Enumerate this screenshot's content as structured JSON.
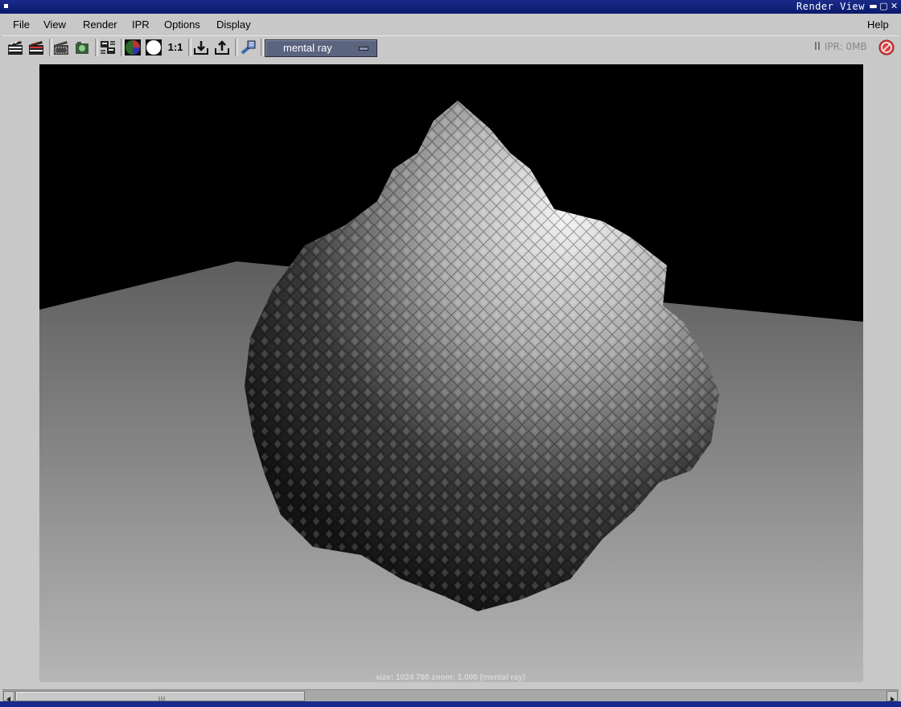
{
  "window": {
    "title": "Render View"
  },
  "menubar": {
    "items": [
      "File",
      "View",
      "Render",
      "IPR",
      "Options",
      "Display"
    ],
    "help": "Help"
  },
  "toolbar": {
    "buttons": [
      "render-icon",
      "redo-render-icon",
      "render-region-icon",
      "snapshot-icon",
      "render-settings-icon",
      "color-channels-icon",
      "alpha-channel-icon",
      "real-size-icon",
      "keep-image-icon",
      "remove-image-icon",
      "ipr-tuning-icon"
    ],
    "real_size_label": "1:1",
    "renderer": "mental ray",
    "ipr_status": "IPR: 0MB"
  },
  "viewport": {
    "status": "size: 1024  768 zoom: 1.000  (mental ray)"
  },
  "colors": {
    "titlebar": "#1a2a8a",
    "renderer_bg": "#5b647e",
    "chrome": "#c8c8c8"
  }
}
